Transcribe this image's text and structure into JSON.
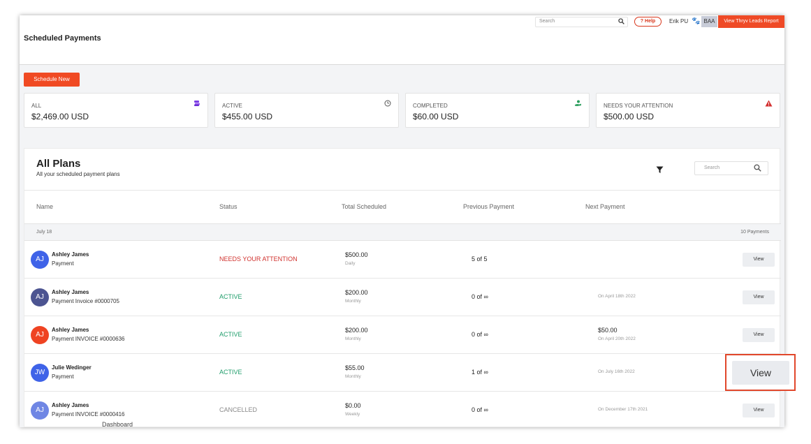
{
  "topbar": {
    "search_placeholder": "Search",
    "help_label": "Help",
    "user_name": "Erik PU",
    "account_badge": "BAA",
    "leads_report_label": "View Thryv Leads Report"
  },
  "header": {
    "title": "Scheduled Payments"
  },
  "actions": {
    "schedule_new_label": "Schedule New"
  },
  "summary_cards": [
    {
      "label": "ALL",
      "value": "$2,469.00 USD",
      "icon": "stack-icon"
    },
    {
      "label": "ACTIVE",
      "value": "$455.00 USD",
      "icon": "clock-icon"
    },
    {
      "label": "COMPLETED",
      "value": "$60.00 USD",
      "icon": "hand-money-icon"
    },
    {
      "label": "NEEDS YOUR ATTENTION",
      "value": "$500.00 USD",
      "icon": "warning-icon"
    }
  ],
  "plans": {
    "title": "All Plans",
    "subtitle": "All your scheduled payment plans",
    "search_placeholder": "Search",
    "columns": [
      "Name",
      "Status",
      "Total Scheduled",
      "Previous Payment",
      "Next Payment"
    ],
    "group": {
      "date": "July 18",
      "count": "10 Payments"
    },
    "rows": [
      {
        "initials": "AJ",
        "avatar_color": "#3f63e8",
        "name": "Ashley James",
        "desc": "Payment",
        "status": "NEEDS YOUR ATTENTION",
        "status_color": "#d0312d",
        "amount": "$500.00",
        "frequency": "Daily",
        "previous": "5 of 5",
        "next_amount": "",
        "next_date": "",
        "view_label": "View"
      },
      {
        "initials": "AJ",
        "avatar_color": "#4c5491",
        "name": "Ashley James",
        "desc": "Payment Invoice #0000705",
        "status": "ACTIVE",
        "status_color": "#1f9d6b",
        "amount": "$200.00",
        "frequency": "Monthly",
        "previous": "0 of ∞",
        "next_amount": "",
        "next_date": "On April 18th 2022",
        "view_label": "View"
      },
      {
        "initials": "AJ",
        "avatar_color": "#ef4322",
        "name": "Ashley James",
        "desc": "Payment INVOICE #0000636",
        "status": "ACTIVE",
        "status_color": "#1f9d6b",
        "amount": "$200.00",
        "frequency": "Monthly",
        "previous": "0 of ∞",
        "next_amount": "$50.00",
        "next_date": "On April 20th 2022",
        "view_label": "View"
      },
      {
        "initials": "JW",
        "avatar_color": "#3f63e8",
        "name": "Julie Wedinger",
        "desc": "Payment",
        "status": "ACTIVE",
        "status_color": "#1f9d6b",
        "amount": "$55.00",
        "frequency": "Monthly",
        "previous": "1 of ∞",
        "next_amount": "",
        "next_date": "On July 16th 2022",
        "view_label": "View"
      },
      {
        "initials": "AJ",
        "avatar_color": "#6f86e4",
        "name": "Ashley James",
        "desc": "Payment INVOICE #0000416",
        "status": "CANCELLED",
        "status_color": "#8a8a8a",
        "amount": "$0.00",
        "frequency": "Weekly",
        "previous": "0 of ∞",
        "next_amount": "",
        "next_date": "On December 17th 2021",
        "view_label": "View"
      }
    ]
  },
  "highlight": {
    "view_label": "View"
  },
  "background_text": "Dashboard"
}
